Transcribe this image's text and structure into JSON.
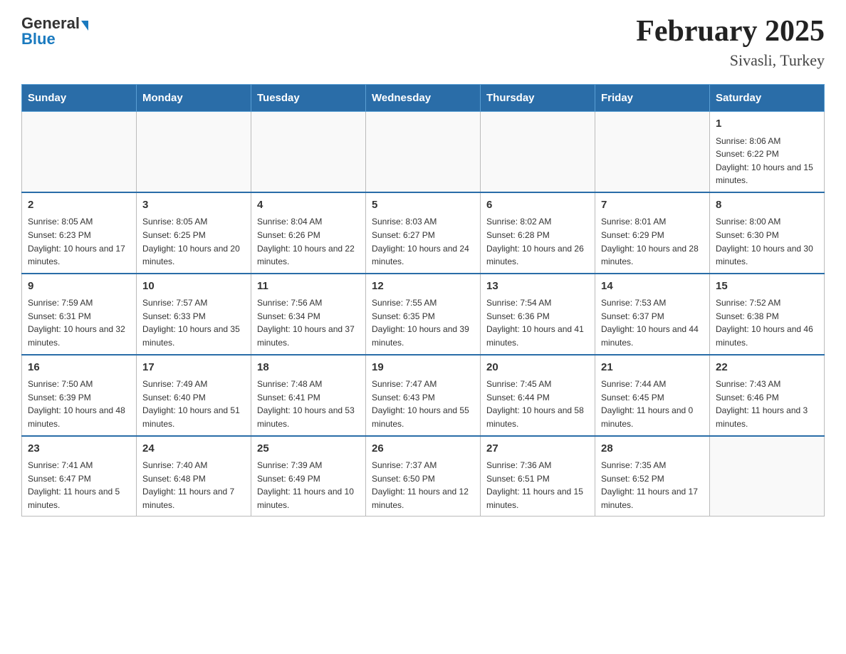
{
  "header": {
    "logo_general": "General",
    "logo_blue": "Blue",
    "title": "February 2025",
    "subtitle": "Sivasli, Turkey"
  },
  "days_of_week": [
    "Sunday",
    "Monday",
    "Tuesday",
    "Wednesday",
    "Thursday",
    "Friday",
    "Saturday"
  ],
  "weeks": [
    [
      {
        "day": "",
        "info": ""
      },
      {
        "day": "",
        "info": ""
      },
      {
        "day": "",
        "info": ""
      },
      {
        "day": "",
        "info": ""
      },
      {
        "day": "",
        "info": ""
      },
      {
        "day": "",
        "info": ""
      },
      {
        "day": "1",
        "info": "Sunrise: 8:06 AM\nSunset: 6:22 PM\nDaylight: 10 hours and 15 minutes."
      }
    ],
    [
      {
        "day": "2",
        "info": "Sunrise: 8:05 AM\nSunset: 6:23 PM\nDaylight: 10 hours and 17 minutes."
      },
      {
        "day": "3",
        "info": "Sunrise: 8:05 AM\nSunset: 6:25 PM\nDaylight: 10 hours and 20 minutes."
      },
      {
        "day": "4",
        "info": "Sunrise: 8:04 AM\nSunset: 6:26 PM\nDaylight: 10 hours and 22 minutes."
      },
      {
        "day": "5",
        "info": "Sunrise: 8:03 AM\nSunset: 6:27 PM\nDaylight: 10 hours and 24 minutes."
      },
      {
        "day": "6",
        "info": "Sunrise: 8:02 AM\nSunset: 6:28 PM\nDaylight: 10 hours and 26 minutes."
      },
      {
        "day": "7",
        "info": "Sunrise: 8:01 AM\nSunset: 6:29 PM\nDaylight: 10 hours and 28 minutes."
      },
      {
        "day": "8",
        "info": "Sunrise: 8:00 AM\nSunset: 6:30 PM\nDaylight: 10 hours and 30 minutes."
      }
    ],
    [
      {
        "day": "9",
        "info": "Sunrise: 7:59 AM\nSunset: 6:31 PM\nDaylight: 10 hours and 32 minutes."
      },
      {
        "day": "10",
        "info": "Sunrise: 7:57 AM\nSunset: 6:33 PM\nDaylight: 10 hours and 35 minutes."
      },
      {
        "day": "11",
        "info": "Sunrise: 7:56 AM\nSunset: 6:34 PM\nDaylight: 10 hours and 37 minutes."
      },
      {
        "day": "12",
        "info": "Sunrise: 7:55 AM\nSunset: 6:35 PM\nDaylight: 10 hours and 39 minutes."
      },
      {
        "day": "13",
        "info": "Sunrise: 7:54 AM\nSunset: 6:36 PM\nDaylight: 10 hours and 41 minutes."
      },
      {
        "day": "14",
        "info": "Sunrise: 7:53 AM\nSunset: 6:37 PM\nDaylight: 10 hours and 44 minutes."
      },
      {
        "day": "15",
        "info": "Sunrise: 7:52 AM\nSunset: 6:38 PM\nDaylight: 10 hours and 46 minutes."
      }
    ],
    [
      {
        "day": "16",
        "info": "Sunrise: 7:50 AM\nSunset: 6:39 PM\nDaylight: 10 hours and 48 minutes."
      },
      {
        "day": "17",
        "info": "Sunrise: 7:49 AM\nSunset: 6:40 PM\nDaylight: 10 hours and 51 minutes."
      },
      {
        "day": "18",
        "info": "Sunrise: 7:48 AM\nSunset: 6:41 PM\nDaylight: 10 hours and 53 minutes."
      },
      {
        "day": "19",
        "info": "Sunrise: 7:47 AM\nSunset: 6:43 PM\nDaylight: 10 hours and 55 minutes."
      },
      {
        "day": "20",
        "info": "Sunrise: 7:45 AM\nSunset: 6:44 PM\nDaylight: 10 hours and 58 minutes."
      },
      {
        "day": "21",
        "info": "Sunrise: 7:44 AM\nSunset: 6:45 PM\nDaylight: 11 hours and 0 minutes."
      },
      {
        "day": "22",
        "info": "Sunrise: 7:43 AM\nSunset: 6:46 PM\nDaylight: 11 hours and 3 minutes."
      }
    ],
    [
      {
        "day": "23",
        "info": "Sunrise: 7:41 AM\nSunset: 6:47 PM\nDaylight: 11 hours and 5 minutes."
      },
      {
        "day": "24",
        "info": "Sunrise: 7:40 AM\nSunset: 6:48 PM\nDaylight: 11 hours and 7 minutes."
      },
      {
        "day": "25",
        "info": "Sunrise: 7:39 AM\nSunset: 6:49 PM\nDaylight: 11 hours and 10 minutes."
      },
      {
        "day": "26",
        "info": "Sunrise: 7:37 AM\nSunset: 6:50 PM\nDaylight: 11 hours and 12 minutes."
      },
      {
        "day": "27",
        "info": "Sunrise: 7:36 AM\nSunset: 6:51 PM\nDaylight: 11 hours and 15 minutes."
      },
      {
        "day": "28",
        "info": "Sunrise: 7:35 AM\nSunset: 6:52 PM\nDaylight: 11 hours and 17 minutes."
      },
      {
        "day": "",
        "info": ""
      }
    ]
  ]
}
